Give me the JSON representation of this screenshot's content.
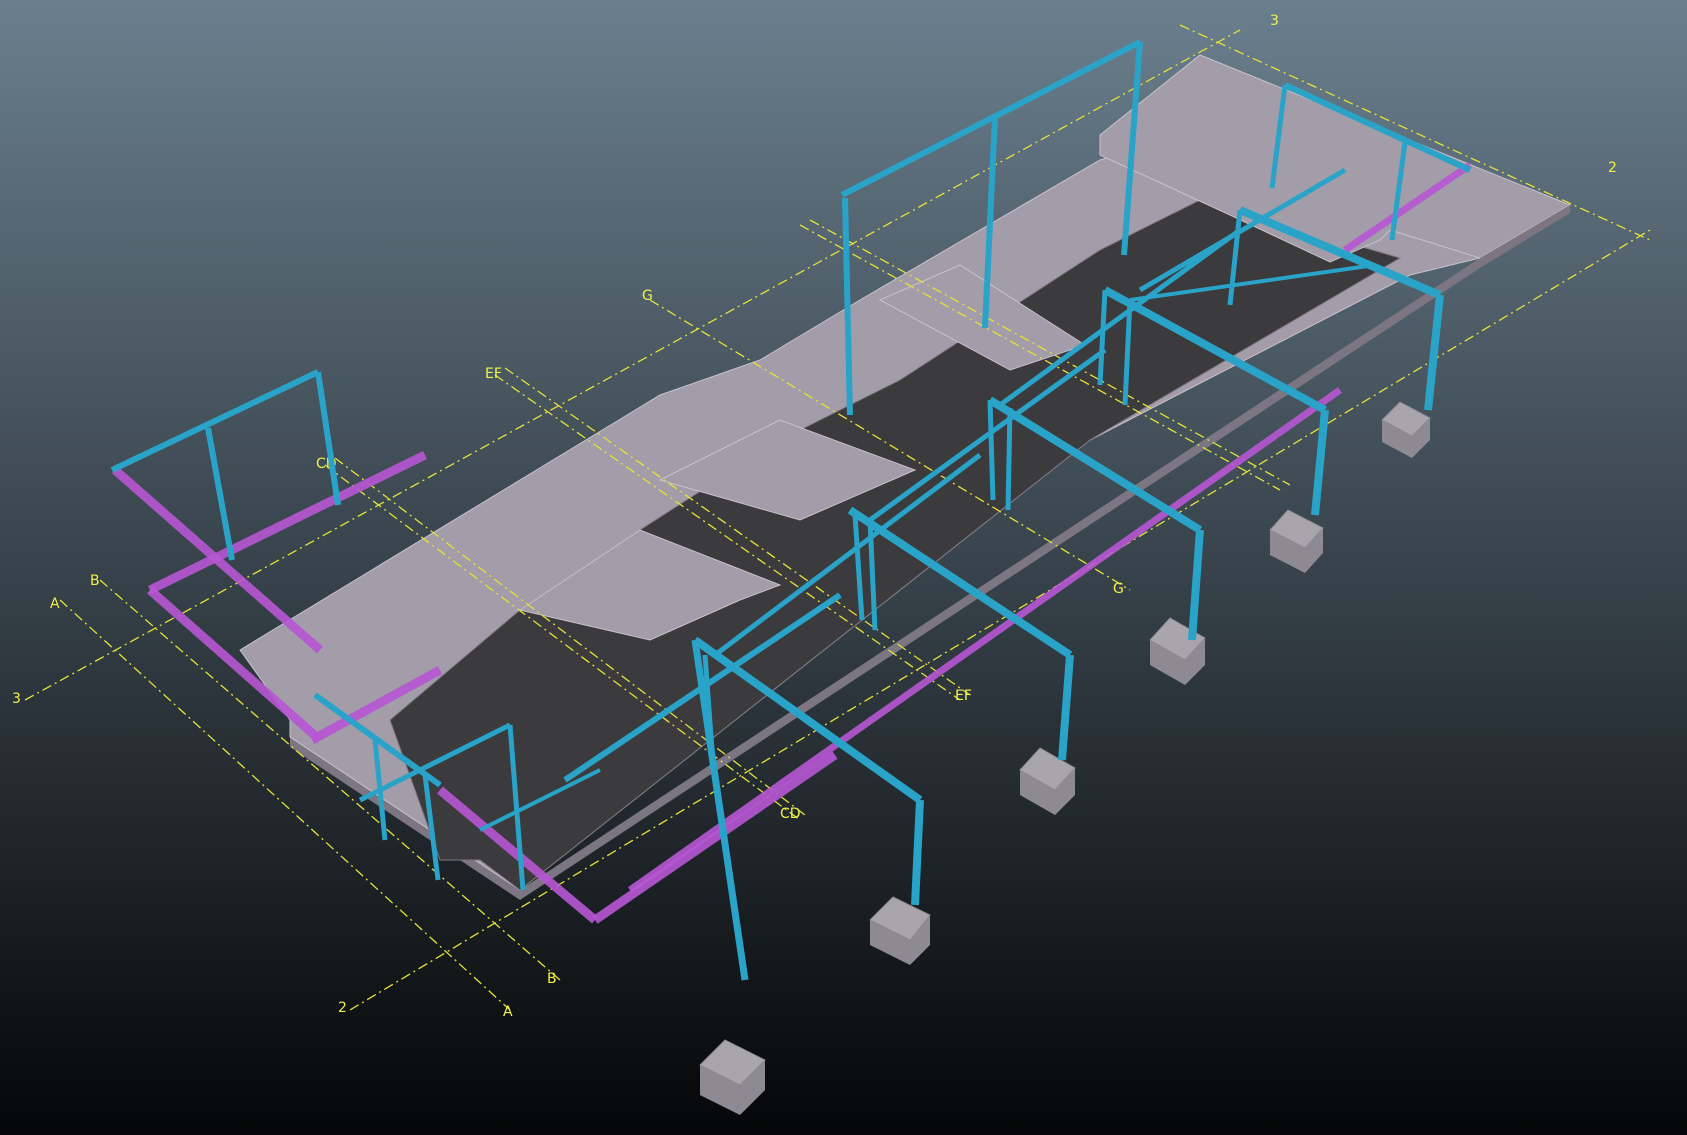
{
  "colors": {
    "background_top": "#6a7f8e",
    "background_bottom": "#050607",
    "grid": "#e3e23a",
    "grid_label": "#f1f04a",
    "slab_light": "#a39ca9",
    "slab_light_edge": "#c8c2cc",
    "slab_side": "#7b7681",
    "slab_dark": "#3b3a3d",
    "frame_blue": "#2aa3c9",
    "frame_blue_dark": "#1a7d9c",
    "frame_pink": "#b757d4",
    "footing_top": "#a9a5ad",
    "footing_side": "#8e8a93"
  },
  "grid_labels": {
    "a_left": "A",
    "b_left": "B",
    "cd_left": "CD",
    "ef_left": "EF",
    "g_left": "G",
    "row3_left": "3",
    "row2_bottom": "2",
    "b_bottom": "B",
    "a_bottom": "A",
    "cd_right": "CD",
    "ef_right": "EF",
    "g_right": "G",
    "row3_top": "3",
    "row2_right": "2"
  }
}
